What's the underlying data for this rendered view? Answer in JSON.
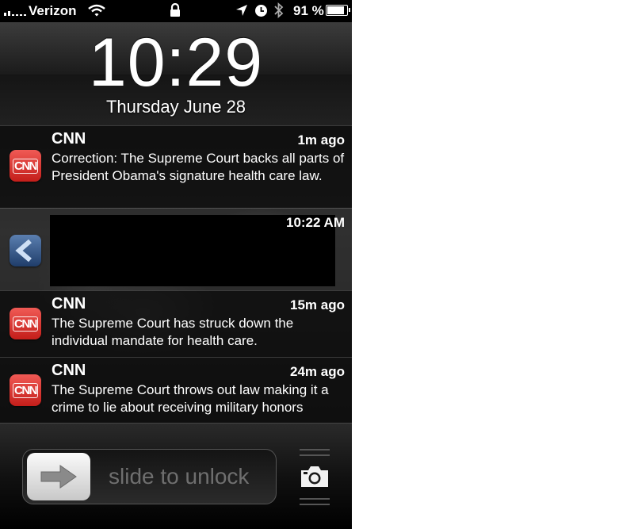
{
  "status_bar": {
    "carrier": "Verizon",
    "battery_percent": "91 %",
    "battery_level": 0.91,
    "icons": [
      "signal-icon",
      "wifi-icon",
      "lock-icon",
      "location-arrow-icon",
      "alarm-clock-icon",
      "bluetooth-icon",
      "battery-icon"
    ]
  },
  "lock_screen": {
    "time": "10:29",
    "date": "Thursday  June 28"
  },
  "notifications": [
    {
      "app": "CNN",
      "time": "1m ago",
      "message": "Correction: The Supreme Court backs all parts of President Obama's signature health care law.",
      "icon": "cnn-app-icon"
    },
    {
      "app": "",
      "time": "10:22 AM",
      "message": "",
      "icon": "app-icon",
      "redacted": true
    },
    {
      "app": "CNN",
      "time": "15m ago",
      "message": "The Supreme Court has struck down the individual mandate for health care.",
      "icon": "cnn-app-icon"
    },
    {
      "app": "CNN",
      "time": "24m ago",
      "message": "The Supreme Court throws out law making it a crime to lie about receiving military honors",
      "icon": "cnn-app-icon"
    }
  ],
  "cnn_logo_text": "CNN",
  "unlock": {
    "label": "slide to unlock",
    "knob_icon": "arrow-right-icon",
    "camera_icon": "camera-icon"
  },
  "colors": {
    "cnn_red": "#d3302b",
    "background": "#0a0a0a",
    "slider_text": "#6f6f6f"
  }
}
